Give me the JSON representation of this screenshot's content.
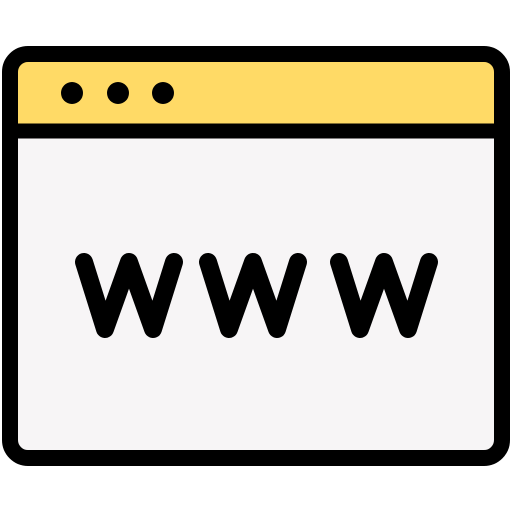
{
  "icon": {
    "semantic": "browser-window-www-icon",
    "address_text": "www",
    "colors": {
      "outline": "#000000",
      "title_bar": "#FFDA66",
      "content": "#F7F5F6",
      "background": "#FFFFFF"
    },
    "window_controls": [
      {
        "name": "control-dot-1"
      },
      {
        "name": "control-dot-2"
      },
      {
        "name": "control-dot-3"
      }
    ]
  }
}
